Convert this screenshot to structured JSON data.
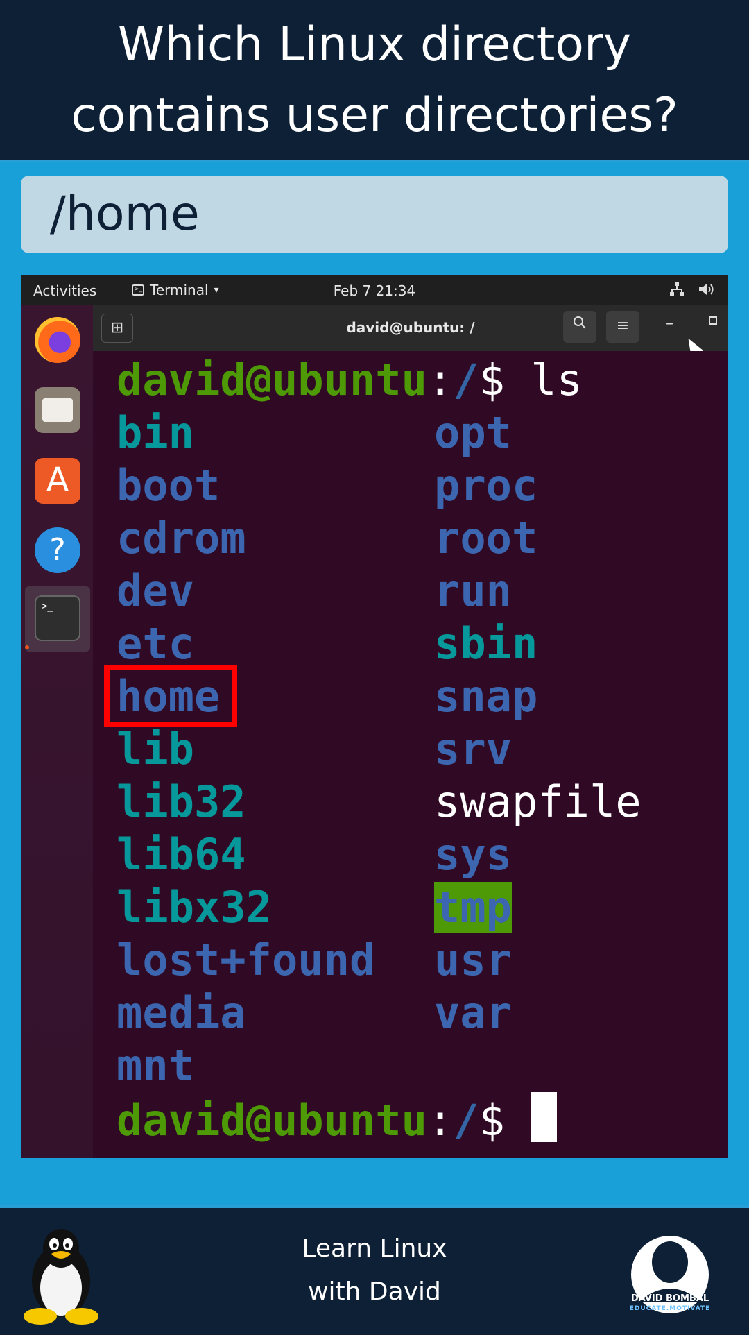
{
  "question": {
    "line1": "Which Linux directory",
    "line2": "contains user directories?"
  },
  "answer": "/home",
  "topbar": {
    "activities": "Activities",
    "app_name": "Terminal",
    "clock": "Feb 7  21:34"
  },
  "dock": {
    "items": [
      "firefox-icon",
      "files-icon",
      "app-store-icon",
      "help-icon",
      "terminal-icon"
    ],
    "terminal_glyph": ">_",
    "help_glyph": "?",
    "store_glyph": "A"
  },
  "terminal": {
    "title": "david@ubuntu: /",
    "prompt_user": "david@ubuntu",
    "prompt_colon": ":",
    "prompt_path": "/",
    "prompt_symbol": "$ ",
    "command": "ls",
    "left_column": [
      "bin",
      "boot",
      "cdrom",
      "dev",
      "etc",
      "home",
      "lib",
      "lib32",
      "lib64",
      "libx32",
      "lost+found",
      "media",
      "mnt"
    ],
    "right_column": [
      "opt",
      "proc",
      "root",
      "run",
      "sbin",
      "snap",
      "srv",
      "swapfile",
      "sys",
      "tmp",
      "usr",
      "var"
    ],
    "highlighted_entry": "home"
  },
  "colors": {
    "header_bg": "#0d2035",
    "page_bg": "#1aa0d8",
    "answer_bg": "#bfd8e4",
    "terminal_bg": "#300a24",
    "prompt_green": "#4e9a06",
    "dir_blue": "#3c66b0",
    "symlink_cyan": "#06989a",
    "highlight_red": "#ff0000"
  },
  "footer": {
    "line1": "Learn Linux",
    "line2": "with David",
    "brand_name": "DAVID BOMBAL",
    "brand_tagline": "EDUCATE.MOTIVATE"
  }
}
